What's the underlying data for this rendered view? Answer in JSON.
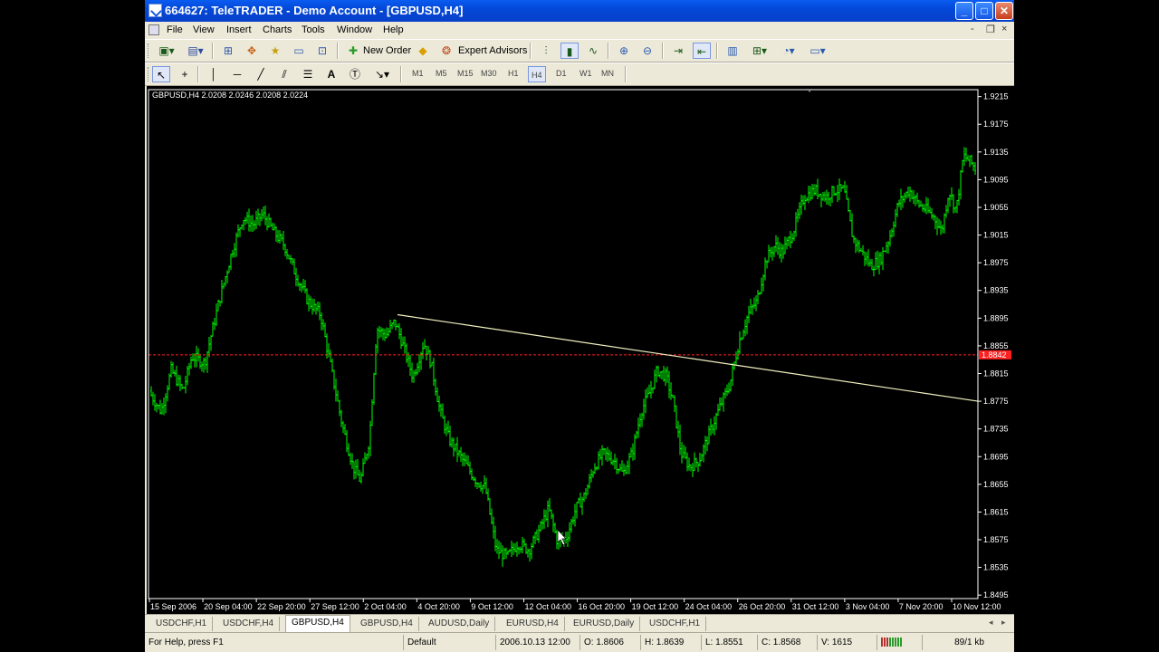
{
  "window": {
    "title": "664627: TeleTRADER - Demo Account - [GBPUSD,H4]",
    "buttons": {
      "minimize": "_",
      "maximize": "□",
      "close": "✕"
    }
  },
  "menu": {
    "items": [
      "File",
      "View",
      "Insert",
      "Charts",
      "Tools",
      "Window",
      "Help"
    ],
    "mdi": {
      "minimize": "-",
      "restore": "❐",
      "close": "×"
    }
  },
  "toolbar": {
    "new_order_label": "New Order",
    "expert_advisors_label": "Expert Advisors",
    "icons": [
      "new-chart-icon",
      "profiles-icon",
      "market-watch-icon",
      "navigator-icon",
      "favorites-icon",
      "terminal-icon",
      "strategy-tester-icon",
      "new-order-icon",
      "alert-icon",
      "expert-advisors-icon",
      "bar-chart-icon",
      "candlesticks-icon",
      "line-chart-icon",
      "zoom-in-icon",
      "zoom-out-icon",
      "autoscroll-icon",
      "chart-shift-icon",
      "indicators-icon",
      "templates-icon",
      "periods-icon",
      "templates-menu-icon"
    ]
  },
  "drawtools": {
    "timeframes": [
      "M1",
      "M5",
      "M15",
      "M30",
      "H1",
      "H4",
      "D1",
      "W1",
      "MN"
    ],
    "active_timeframe": "H4"
  },
  "chart_data": {
    "type": "bar",
    "symbol_info": "GBPUSD,H4  2.0208 2.0246 2.0208 2.0224",
    "background": "#000000",
    "bar_color": "#00ff00",
    "trendline_color": "#f0f0c0",
    "price_line_color": "#ff2020",
    "current_price": 1.8842,
    "current_price_label": "1.8842",
    "ylim": [
      1.849,
      1.9225
    ],
    "y_ticks": [
      "1.9215",
      "1.9175",
      "1.9135",
      "1.9095",
      "1.9055",
      "1.9015",
      "1.8975",
      "1.8935",
      "1.8895",
      "1.8855",
      "1.8815",
      "1.8775",
      "1.8735",
      "1.8695",
      "1.8655",
      "1.8615",
      "1.8575",
      "1.8535",
      "1.8495"
    ],
    "x_ticks": [
      "15 Sep 2006",
      "20 Sep 04:00",
      "22 Sep 20:00",
      "27 Sep 12:00",
      "2 Oct 04:00",
      "4 Oct 20:00",
      "9 Oct 12:00",
      "12 Oct 04:00",
      "16 Oct 20:00",
      "19 Oct 12:00",
      "24 Oct 04:00",
      "26 Oct 20:00",
      "31 Oct 12:00",
      "3 Nov 04:00",
      "7 Nov 20:00",
      "10 Nov 12:00"
    ],
    "price_path": [
      [
        0,
        1.879
      ],
      [
        14,
        1.876
      ],
      [
        25,
        1.882
      ],
      [
        38,
        1.879
      ],
      [
        48,
        1.884
      ],
      [
        62,
        1.883
      ],
      [
        78,
        1.892
      ],
      [
        92,
        1.899
      ],
      [
        104,
        1.904
      ],
      [
        116,
        1.903
      ],
      [
        126,
        1.9045
      ],
      [
        138,
        1.902
      ],
      [
        150,
        1.9
      ],
      [
        162,
        1.896
      ],
      [
        176,
        1.892
      ],
      [
        190,
        1.89
      ],
      [
        202,
        1.882
      ],
      [
        214,
        1.874
      ],
      [
        226,
        1.868
      ],
      [
        234,
        1.866
      ],
      [
        244,
        1.872
      ],
      [
        252,
        1.888
      ],
      [
        262,
        1.887
      ],
      [
        272,
        1.889
      ],
      [
        280,
        1.886
      ],
      [
        292,
        1.881
      ],
      [
        304,
        1.886
      ],
      [
        312,
        1.883
      ],
      [
        322,
        1.876
      ],
      [
        332,
        1.872
      ],
      [
        342,
        1.87
      ],
      [
        352,
        1.868
      ],
      [
        362,
        1.866
      ],
      [
        372,
        1.865
      ],
      [
        384,
        1.856
      ],
      [
        396,
        1.855
      ],
      [
        408,
        1.857
      ],
      [
        420,
        1.856
      ],
      [
        432,
        1.859
      ],
      [
        442,
        1.862
      ],
      [
        452,
        1.857
      ],
      [
        462,
        1.858
      ],
      [
        472,
        1.862
      ],
      [
        482,
        1.864
      ],
      [
        492,
        1.868
      ],
      [
        502,
        1.87
      ],
      [
        514,
        1.869
      ],
      [
        524,
        1.867
      ],
      [
        534,
        1.87
      ],
      [
        544,
        1.876
      ],
      [
        554,
        1.879
      ],
      [
        562,
        1.882
      ],
      [
        572,
        1.881
      ],
      [
        580,
        1.877
      ],
      [
        588,
        1.87
      ],
      [
        598,
        1.868
      ],
      [
        608,
        1.869
      ],
      [
        620,
        1.873
      ],
      [
        632,
        1.877
      ],
      [
        642,
        1.88
      ],
      [
        652,
        1.886
      ],
      [
        662,
        1.89
      ],
      [
        672,
        1.892
      ],
      [
        682,
        1.898
      ],
      [
        692,
        1.9
      ],
      [
        700,
        1.899
      ],
      [
        712,
        1.902
      ],
      [
        724,
        1.907
      ],
      [
        736,
        1.908
      ],
      [
        748,
        1.907
      ],
      [
        758,
        1.908
      ],
      [
        768,
        1.908
      ],
      [
        778,
        1.901
      ],
      [
        788,
        1.899
      ],
      [
        798,
        1.897
      ],
      [
        808,
        1.898
      ],
      [
        818,
        1.901
      ],
      [
        828,
        1.906
      ],
      [
        840,
        1.908
      ],
      [
        850,
        1.906
      ],
      [
        860,
        1.905
      ],
      [
        868,
        1.904
      ],
      [
        876,
        1.902
      ],
      [
        884,
        1.908
      ],
      [
        892,
        1.905
      ],
      [
        900,
        1.913
      ],
      [
        908,
        1.912
      ],
      [
        914,
        1.911
      ]
    ],
    "trendline": [
      [
        275,
        1.89
      ],
      [
        916,
        1.8775
      ]
    ]
  },
  "tabs": {
    "items": [
      "USDCHF,H1",
      "USDCHF,H4",
      "GBPUSD,H4",
      "GBPUSD,H4",
      "AUDUSD,Daily",
      "EURUSD,H4",
      "EURUSD,Daily",
      "USDCHF,H1"
    ],
    "active_index": 2,
    "nav_prev": "◂",
    "nav_next": "▸"
  },
  "status": {
    "help": "For Help, press F1",
    "profile": "Default",
    "datetime": "2006.10.13 12:00",
    "open": "O: 1.8606",
    "high": "H: 1.8639",
    "low": "L: 1.8551",
    "close": "C: 1.8568",
    "volume": "V: 1615",
    "traffic": "89/1 kb"
  }
}
